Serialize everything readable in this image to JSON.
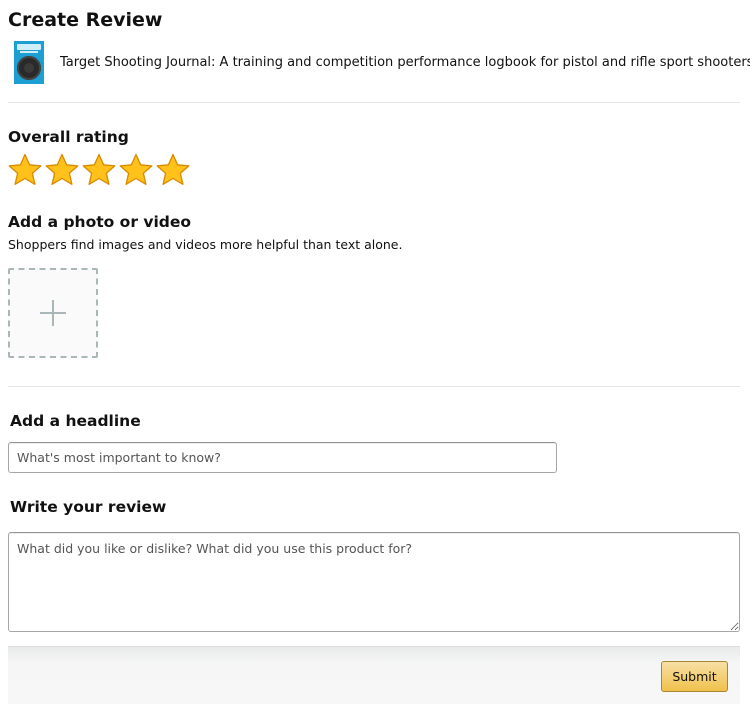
{
  "page": {
    "title": "Create Review"
  },
  "product": {
    "title": "Target Shooting Journal: A training and competition performance logbook for pistol and rifle sport shooters",
    "thumbnail_icon": "book-cover-thumbnail"
  },
  "rating": {
    "heading": "Overall rating",
    "max": 5,
    "selected": 5,
    "star_color": "#ffc11a"
  },
  "media": {
    "heading": "Add a photo or video",
    "subtext": "Shoppers find images and videos more helpful than text alone.",
    "upload_icon": "plus-icon"
  },
  "headline": {
    "heading": "Add a headline",
    "placeholder": "What's most important to know?",
    "value": ""
  },
  "review": {
    "heading": "Write your review",
    "placeholder": "What did you like or dislike? What did you use this product for?",
    "value": ""
  },
  "actions": {
    "submit_label": "Submit",
    "submit_color": "#f0c14b"
  }
}
